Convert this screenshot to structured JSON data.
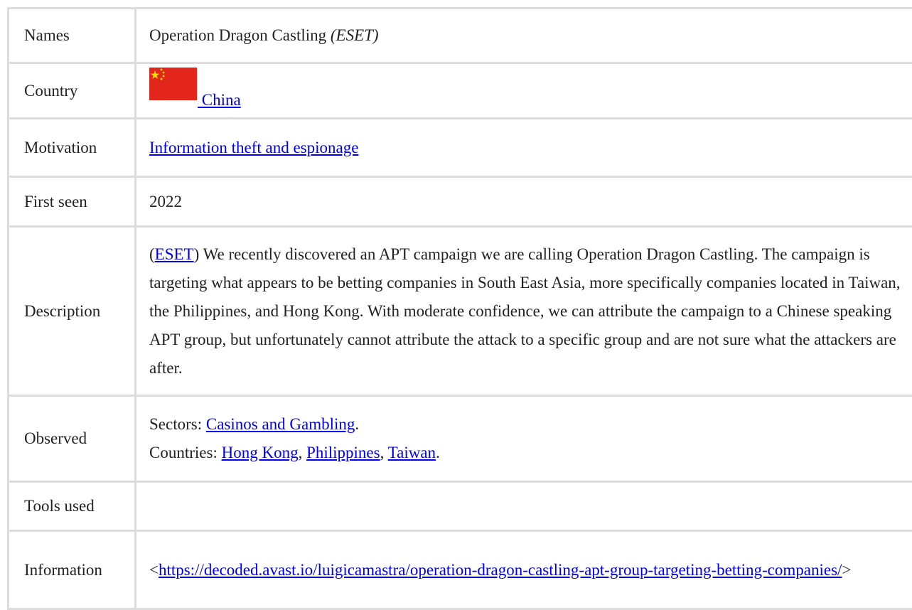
{
  "rows": {
    "names": {
      "label": "Names",
      "value": "Operation Dragon Castling ",
      "alias": "(ESET)"
    },
    "country": {
      "label": "Country",
      "flag_icon": "china-flag-icon",
      "flag_colors": {
        "field": "#e3261b",
        "stars": "#ffde00"
      },
      "link": " China"
    },
    "motivation": {
      "label": "Motivation",
      "link": "Information theft and espionage"
    },
    "first_seen": {
      "label": "First seen",
      "value": "2022"
    },
    "description": {
      "label": "Description",
      "open_paren": "(",
      "source_link": "ESET",
      "text": ") We recently discovered an APT campaign we are calling Operation Dragon Castling. The campaign is targeting what appears to be betting companies in South East Asia, more specifically companies located in Taiwan, the Philippines, and Hong Kong. With moderate confidence, we can attribute the campaign to a Chinese speaking APT group, but unfortunately cannot attribute the attack to a specific group and are not sure what the attackers are after."
    },
    "observed": {
      "label": "Observed",
      "sectors_prefix": "Sectors: ",
      "sectors": [
        "Casinos and Gambling"
      ],
      "sectors_suffix": ".",
      "countries_prefix": "Countries: ",
      "countries": [
        "Hong Kong",
        "Philippines",
        "Taiwan"
      ],
      "separator": ", ",
      "countries_suffix": "."
    },
    "tools_used": {
      "label": "Tools used",
      "value": ""
    },
    "information": {
      "label": "Information",
      "lt": "<",
      "link": "https://decoded.avast.io/luigicamastra/operation-dragon-castling-apt-group-targeting-betting-companies/",
      "gt": ">"
    }
  }
}
